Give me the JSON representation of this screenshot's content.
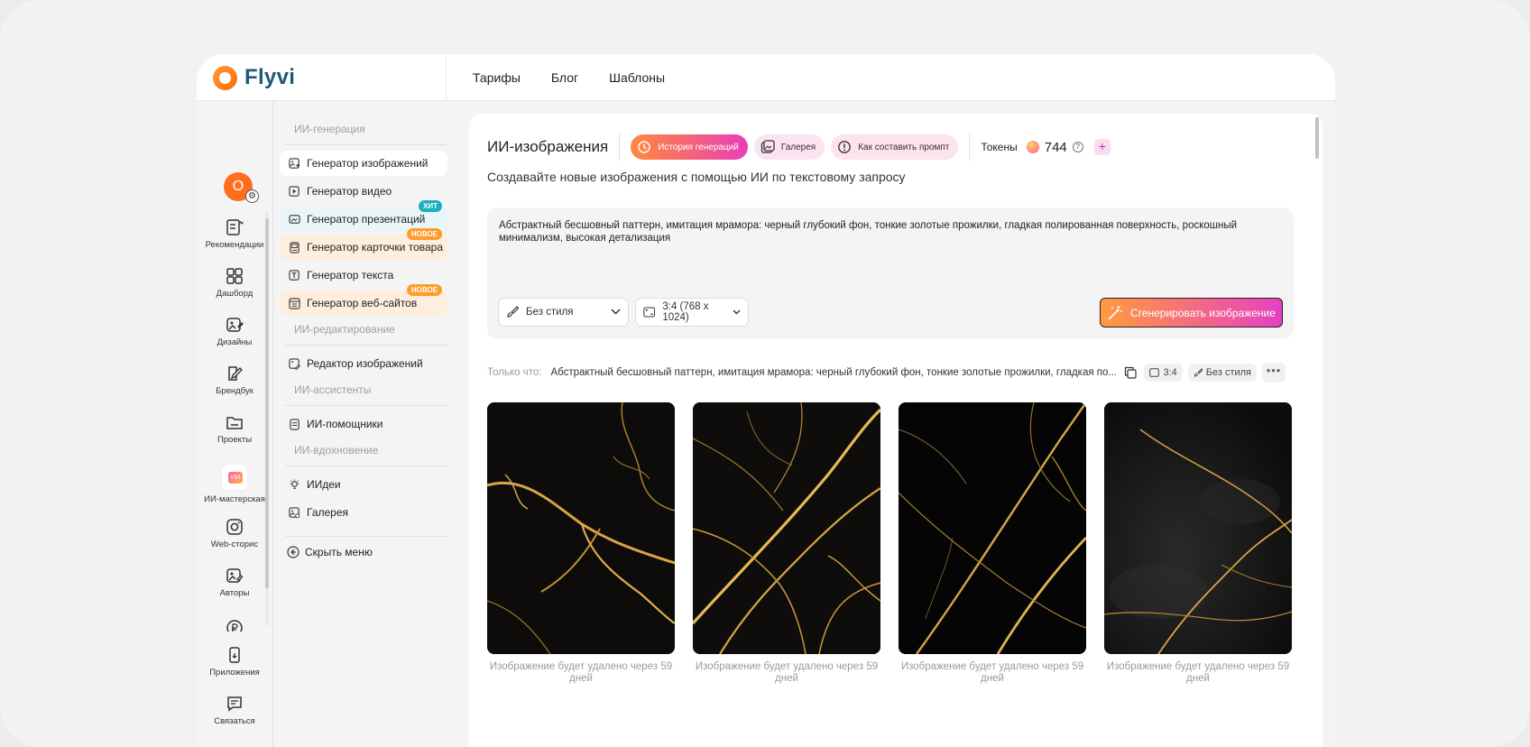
{
  "brand": {
    "name": "Flyvi"
  },
  "topnav": [
    "Тарифы",
    "Блог",
    "Шаблоны"
  ],
  "user": {
    "initial": "O"
  },
  "rail": [
    {
      "label": "Рекомендации",
      "icon": "recommendations-icon"
    },
    {
      "label": "Дашборд",
      "icon": "dashboard-icon"
    },
    {
      "label": "Дизайны",
      "icon": "designs-icon"
    },
    {
      "label": "Брендбук",
      "icon": "brandbook-icon"
    },
    {
      "label": "Проекты",
      "icon": "folder-icon"
    },
    {
      "label": "ИИ-мастерская",
      "icon": "ai-workshop-icon",
      "badge": "ИИ"
    },
    {
      "label": "Web-сторис",
      "icon": "web-stories-icon"
    },
    {
      "label": "Авторы",
      "icon": "authors-icon"
    },
    {
      "label": "",
      "icon": "ruble-icon"
    },
    {
      "label": "Приложения",
      "icon": "apps-icon"
    },
    {
      "label": "Связаться",
      "icon": "chat-icon"
    }
  ],
  "submenu": {
    "gen_heading": "ИИ-генерация",
    "gen_items": [
      {
        "label": "Генератор изображений",
        "state": "active"
      },
      {
        "label": "Генератор видео"
      },
      {
        "label": "Генератор презентаций",
        "badge": "ХИТ"
      },
      {
        "label": "Генератор карточки товара",
        "badge": "НОВОЕ"
      },
      {
        "label": "Генератор текста"
      },
      {
        "label": "Генератор веб-сайтов",
        "badge": "НОВОЕ"
      }
    ],
    "edit_heading": "ИИ-редактирование",
    "edit_items": [
      {
        "label": "Редактор изображений"
      }
    ],
    "assist_heading": "ИИ-ассистенты",
    "assist_items": [
      {
        "label": "ИИ-помощники"
      }
    ],
    "inspire_heading": "ИИ-вдохновение",
    "inspire_items": [
      {
        "label": "ИИдеи"
      },
      {
        "label": "Галерея"
      }
    ],
    "hide_label": "Скрыть меню"
  },
  "main": {
    "title": "ИИ-изображения",
    "pills": {
      "history": "История генераций",
      "gallery": "Галерея",
      "prompt_help": "Как составить промпт"
    },
    "tokens_label": "Токены",
    "tokens_value": "744",
    "subtitle": "Создавайте новые изображения с помощью ИИ по текстовому запросу",
    "prompt": "Абстрактный бесшовный паттерн, имитация мрамора: черный глубокий фон, тонкие золотые прожилки, гладкая полированная поверхность, роскошный минимализм, высокая детализация",
    "style_select": "Без стиля",
    "ratio_select": "3:4 (768 x 1024)",
    "generate_button": "Сгенерировать изображение",
    "recent_label": "Только что:",
    "recent_prompt": "Абстрактный бесшовный паттерн, имитация мрамора: черный глубокий фон, тонкие золотые прожилки, гладкая по...",
    "recent_ratio": "3:4",
    "recent_style": "Без стиля",
    "more": "•••",
    "images": [
      {
        "caption": "Изображение будет удалено через 59 дней"
      },
      {
        "caption": "Изображение будет удалено через 59 дней"
      },
      {
        "caption": "Изображение будет удалено через 59 дней"
      },
      {
        "caption": "Изображение будет удалено через 59 дней"
      }
    ]
  },
  "colors": {
    "accent_orange": "#ff6d1f",
    "brand_blue": "#1d5a78",
    "gradient_start": "#ff9b3d",
    "gradient_end": "#e640c2",
    "badge_hit": "#1ab0bd",
    "badge_new": "#ff9c2a"
  }
}
